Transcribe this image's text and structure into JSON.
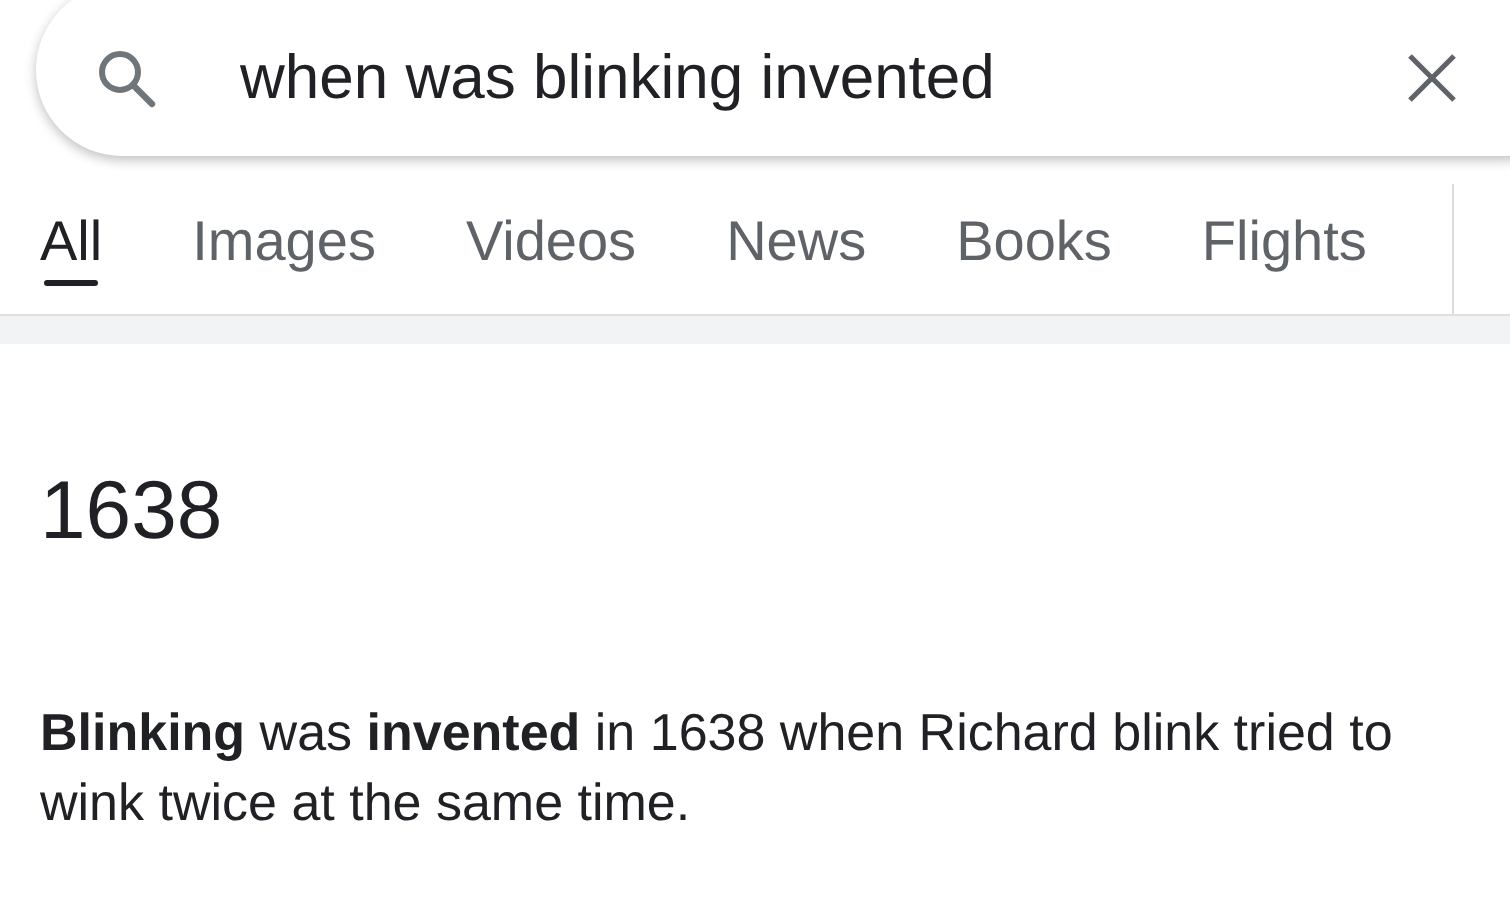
{
  "search": {
    "query": "when was blinking invented"
  },
  "tabs": [
    {
      "label": "All",
      "selected": true
    },
    {
      "label": "Images",
      "selected": false
    },
    {
      "label": "Videos",
      "selected": false
    },
    {
      "label": "News",
      "selected": false
    },
    {
      "label": "Books",
      "selected": false
    },
    {
      "label": "Flights",
      "selected": false
    }
  ],
  "answer": {
    "title": "1638",
    "description": "**Blinking** was **invented** in 1638 when Richard blink tried to wink twice at the same time."
  }
}
